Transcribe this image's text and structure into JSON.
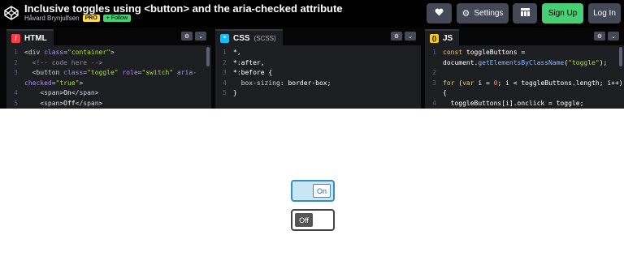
{
  "header": {
    "title": "Inclusive toggles using <button> and the aria-checked attribute",
    "author": "Håvard Brynjulfsen",
    "pro_badge": "PRO",
    "follow_label": "+ Follow",
    "settings_label": "Settings",
    "signup_label": "Sign Up",
    "login_label": "Log In",
    "icons": {
      "logo": "codepen-logo-icon",
      "heart": "heart-icon",
      "settings": "gear-icon",
      "layout": "layout-icon"
    },
    "colors": {
      "signup": "#47cf73",
      "pro": "#ffdd40"
    }
  },
  "editors": {
    "html": {
      "label": "HTML",
      "lines": [
        {
          "num": "1",
          "tokens": [
            {
              "c": "t-tag",
              "t": "<div "
            },
            {
              "c": "t-attr",
              "t": "class"
            },
            {
              "c": "t-tag",
              "t": "="
            },
            {
              "c": "t-str",
              "t": "\"container\""
            },
            {
              "c": "t-tag",
              "t": ">"
            }
          ]
        },
        {
          "num": "2",
          "tokens": [
            {
              "c": "t-comment",
              "t": "  <!-- code here -->"
            }
          ]
        },
        {
          "num": "3",
          "tokens": [
            {
              "c": "t-tag",
              "t": "  <button "
            },
            {
              "c": "t-attr",
              "t": "class"
            },
            {
              "c": "t-tag",
              "t": "="
            },
            {
              "c": "t-str",
              "t": "\"toggle\""
            },
            {
              "c": "t-tag",
              "t": " "
            },
            {
              "c": "t-attr",
              "t": "role"
            },
            {
              "c": "t-tag",
              "t": "="
            },
            {
              "c": "t-str",
              "t": "\"switch\""
            },
            {
              "c": "t-tag",
              "t": " "
            },
            {
              "c": "t-attr",
              "t": "aria-"
            }
          ]
        },
        {
          "num": "",
          "tokens": [
            {
              "c": "t-attr",
              "t": "checked"
            },
            {
              "c": "t-tag",
              "t": "="
            },
            {
              "c": "t-str",
              "t": "\"true\""
            },
            {
              "c": "t-tag",
              "t": ">"
            }
          ]
        },
        {
          "num": "4",
          "tokens": [
            {
              "c": "t-tag",
              "t": "    <span>"
            },
            {
              "c": "t-text",
              "t": "On"
            },
            {
              "c": "t-tag",
              "t": "</span>"
            }
          ]
        },
        {
          "num": "5",
          "tokens": [
            {
              "c": "t-tag",
              "t": "    <span>"
            },
            {
              "c": "t-text",
              "t": "Off"
            },
            {
              "c": "t-tag",
              "t": "</span>"
            }
          ]
        }
      ]
    },
    "css": {
      "label": "CSS",
      "sublabel": "(SCSS)",
      "lines": [
        {
          "num": "1",
          "tokens": [
            {
              "c": "t-text",
              "t": "*,"
            }
          ]
        },
        {
          "num": "2",
          "tokens": [
            {
              "c": "t-text",
              "t": "*:after,"
            }
          ]
        },
        {
          "num": "3",
          "tokens": [
            {
              "c": "t-text",
              "t": "*:before {"
            }
          ]
        },
        {
          "num": "4",
          "tokens": [
            {
              "c": "t-prop",
              "t": "  box-sizing"
            },
            {
              "c": "t-text",
              "t": ": "
            },
            {
              "c": "t-val",
              "t": "border-box"
            },
            {
              "c": "t-text",
              "t": ";"
            }
          ]
        },
        {
          "num": "5",
          "tokens": [
            {
              "c": "t-text",
              "t": "}"
            }
          ]
        }
      ]
    },
    "js": {
      "label": "JS",
      "lines": [
        {
          "num": "1",
          "tokens": [
            {
              "c": "t-kw",
              "t": "const"
            },
            {
              "c": "t-text",
              "t": " toggleButtons ="
            }
          ]
        },
        {
          "num": "",
          "tokens": [
            {
              "c": "t-text",
              "t": "document."
            },
            {
              "c": "t-fn",
              "t": "getElementsByClassName"
            },
            {
              "c": "t-text",
              "t": "("
            },
            {
              "c": "t-str",
              "t": "\"toggle\""
            },
            {
              "c": "t-text",
              "t": ");"
            }
          ]
        },
        {
          "num": "2",
          "tokens": [
            {
              "c": "t-text",
              "t": ""
            }
          ]
        },
        {
          "num": "3",
          "tokens": [
            {
              "c": "t-kw",
              "t": "for"
            },
            {
              "c": "t-text",
              "t": " ("
            },
            {
              "c": "t-kw",
              "t": "var"
            },
            {
              "c": "t-text",
              "t": " i = "
            },
            {
              "c": "t-num",
              "t": "0"
            },
            {
              "c": "t-text",
              "t": "; i < toggleButtons.length; i++)"
            }
          ]
        },
        {
          "num": "",
          "tokens": [
            {
              "c": "t-text",
              "t": "{"
            }
          ]
        },
        {
          "num": "4",
          "tokens": [
            {
              "c": "t-text",
              "t": "  toggleButtons[i].onclick = toggle;"
            }
          ]
        }
      ]
    }
  },
  "preview": {
    "toggle_on_label": "On",
    "toggle_off_label": "Off",
    "colors": {
      "on_border": "#3a8fb7",
      "on_bg": "#c8e6f5",
      "off_knob": "#555555"
    }
  }
}
